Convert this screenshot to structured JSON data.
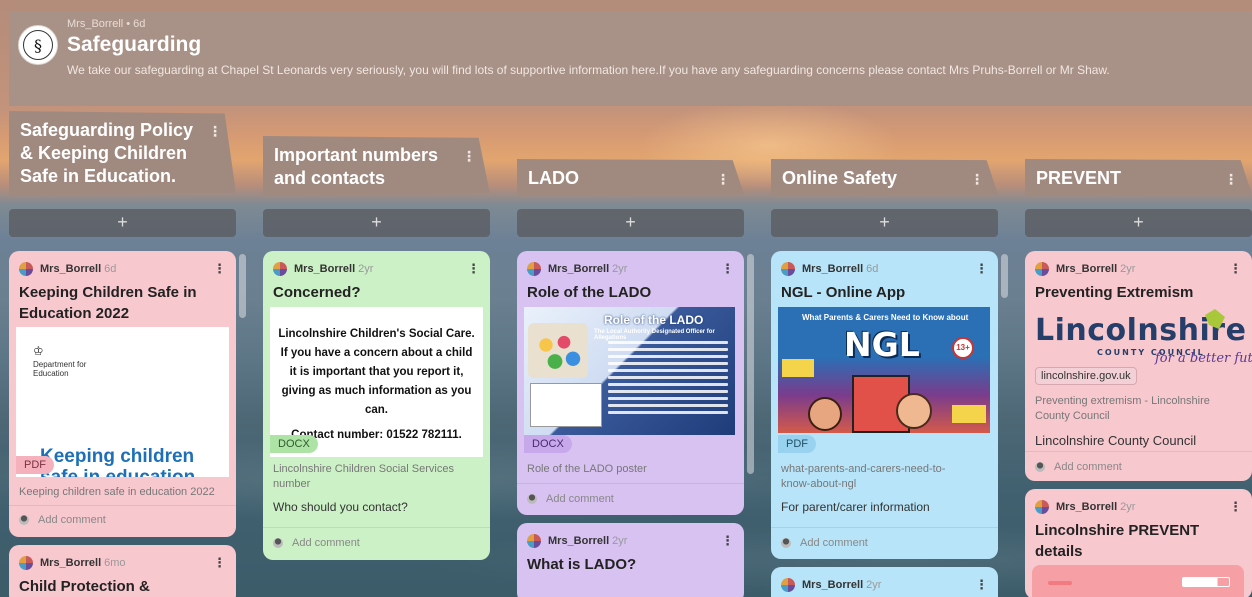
{
  "header": {
    "author": "Mrs_Borrell",
    "age": "6d",
    "separator": "•",
    "title": "Safeguarding",
    "description": "We take our safeguarding at Chapel St Leonards very seriously, you will find lots of supportive information here.If you have any safeguarding concerns please contact Mrs Pruhs-Borrell or Mr Shaw."
  },
  "add_symbol": "+",
  "kebab": "⋮",
  "add_comment": "Add comment",
  "columns": [
    {
      "title": "Safeguarding Policy & Keeping Children Safe in Education.",
      "cards": [
        {
          "author": "Mrs_Borrell",
          "age": "6d",
          "title": "Keeping Children Safe in Education 2022",
          "preview_dept": "Department for Education",
          "preview_big": "Keeping children safe in education",
          "badge": "PDF",
          "caption": "Keeping children safe in education 2022"
        },
        {
          "author": "Mrs_Borrell",
          "age": "6mo",
          "title": "Child Protection &"
        }
      ]
    },
    {
      "title": "Important numbers and contacts",
      "cards": [
        {
          "author": "Mrs_Borrell",
          "age": "2yr",
          "title": "Concerned?",
          "preview_lines": [
            "Lincolnshire Children's Social Care.",
            "If you have a concern about a child",
            "it is important that you report it,",
            "giving as much information as you",
            "can.",
            "Contact number: 01522 782111."
          ],
          "badge": "DOCX",
          "caption": "Lincolnshire Children Social Services number",
          "body": "Who should you contact?"
        }
      ]
    },
    {
      "title": "LADO",
      "cards": [
        {
          "author": "Mrs_Borrell",
          "age": "2yr",
          "title": "Role of the LADO",
          "preview_title": "Role of the LADO",
          "preview_sub": "The Local Authority Designated Officer for Allegations",
          "badge": "DOCX",
          "caption": "Role of the LADO poster"
        },
        {
          "author": "Mrs_Borrell",
          "age": "2yr",
          "title": "What is LADO?"
        }
      ]
    },
    {
      "title": "Online Safety",
      "cards": [
        {
          "author": "Mrs_Borrell",
          "age": "6d",
          "title": "NGL - Online App",
          "preview_top": "What Parents & Carers Need to Know about",
          "preview_big": "NGL",
          "preview_age": "13+",
          "badge": "PDF",
          "caption": "what-parents-and-carers-need-to-know-about-ngl",
          "body": "For parent/carer information"
        },
        {
          "author": "Mrs_Borrell",
          "age": "2yr"
        }
      ]
    },
    {
      "title": "PREVENT",
      "cards": [
        {
          "author": "Mrs_Borrell",
          "age": "2yr",
          "title": "Preventing Extremism",
          "logo_word": "Lincolnshire",
          "logo_cc": "COUNTY COUNCIL",
          "logo_tag": "for a better future",
          "domain": "lincolnshire.gov.uk",
          "caption": "Preventing extremism - Lincolnshire County Council",
          "body": "Lincolnshire County Council"
        },
        {
          "author": "Mrs_Borrell",
          "age": "2yr",
          "title": "Lincolnshire PREVENT details"
        }
      ]
    }
  ]
}
